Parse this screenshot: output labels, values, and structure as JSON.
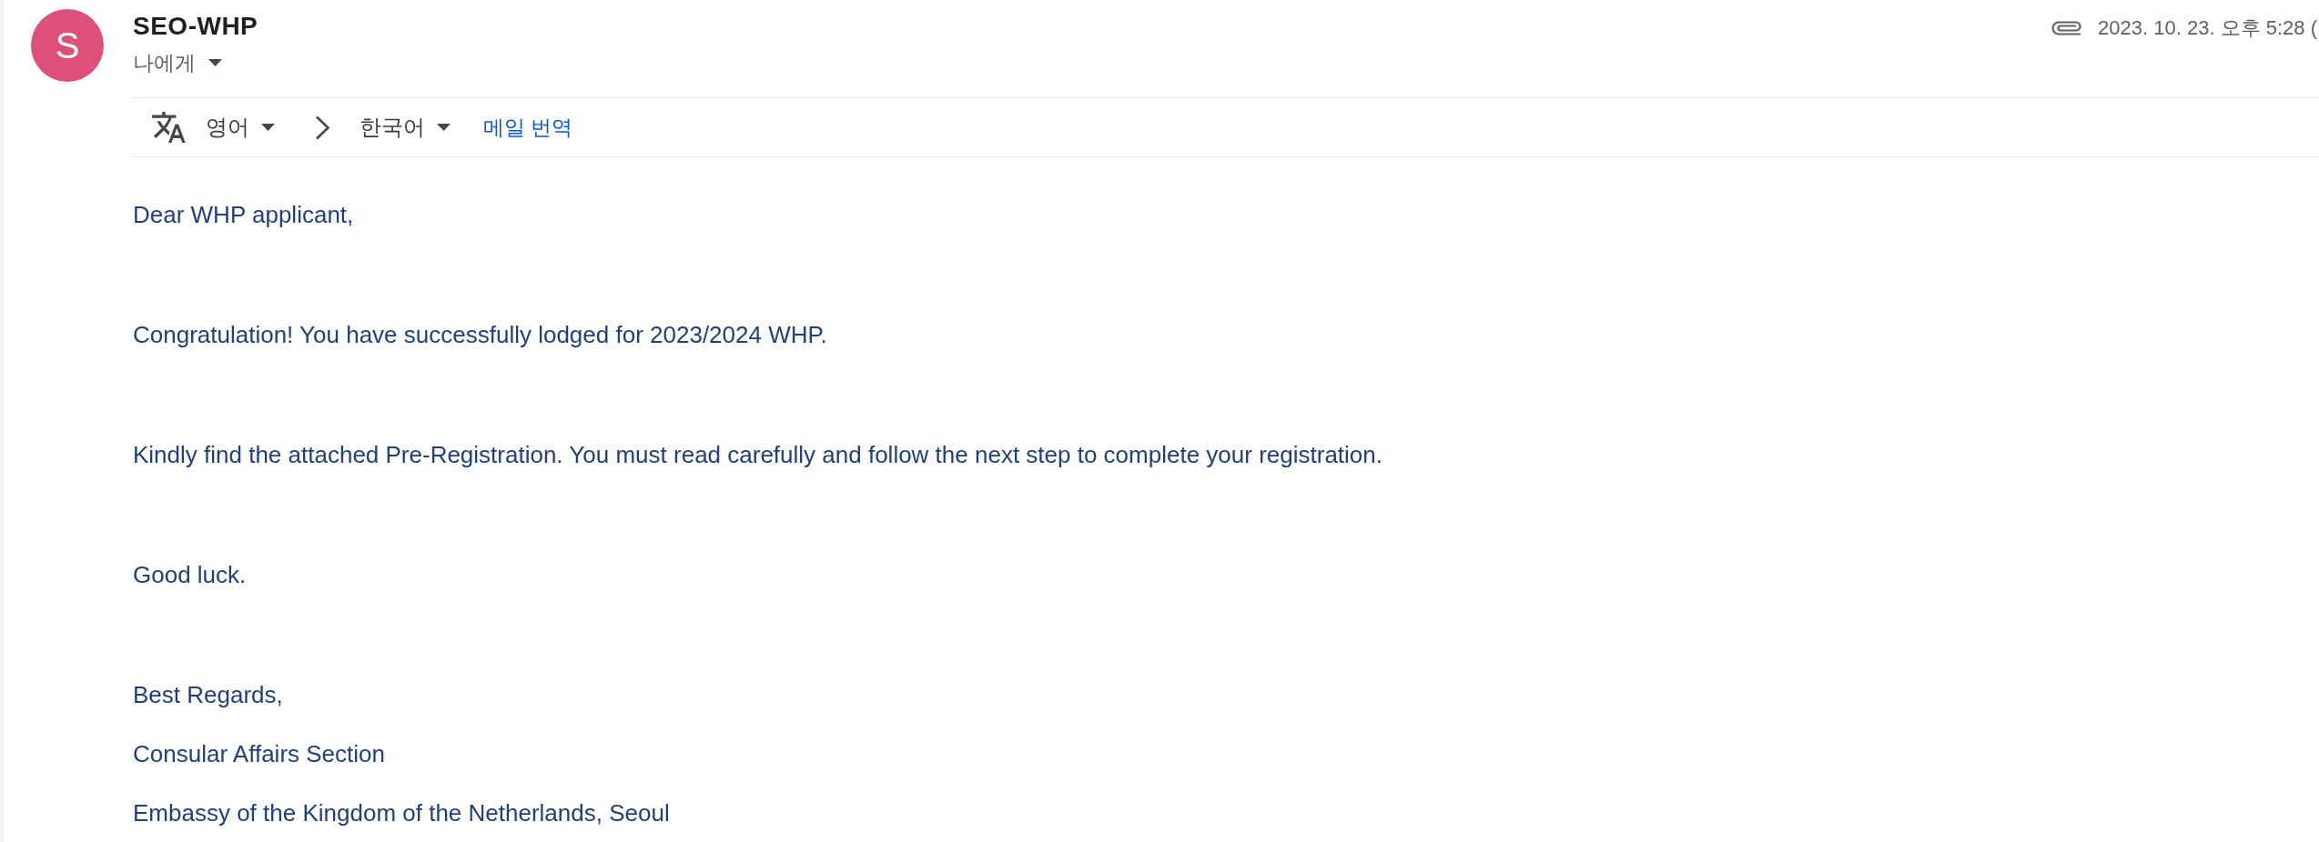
{
  "sender": {
    "avatar_letter": "S",
    "name": "SEO-WHP",
    "recipient": "나에게"
  },
  "meta": {
    "date": "2023. 10. 23. 오후 5:28 ("
  },
  "translate_bar": {
    "source_language": "영어",
    "target_language": "한국어",
    "action": "메일 번역"
  },
  "body": {
    "paragraphs": [
      "Dear WHP applicant,",
      "Congratulation! You have successfully lodged for 2023/2024 WHP.",
      "Kindly find the attached Pre-Registration. You must read carefully and follow the next step to complete your registration.",
      "Good luck."
    ],
    "signature": [
      "Best Regards,",
      "Consular Affairs Section",
      "Embassy of the Kingdom of the Netherlands, Seoul"
    ]
  }
}
